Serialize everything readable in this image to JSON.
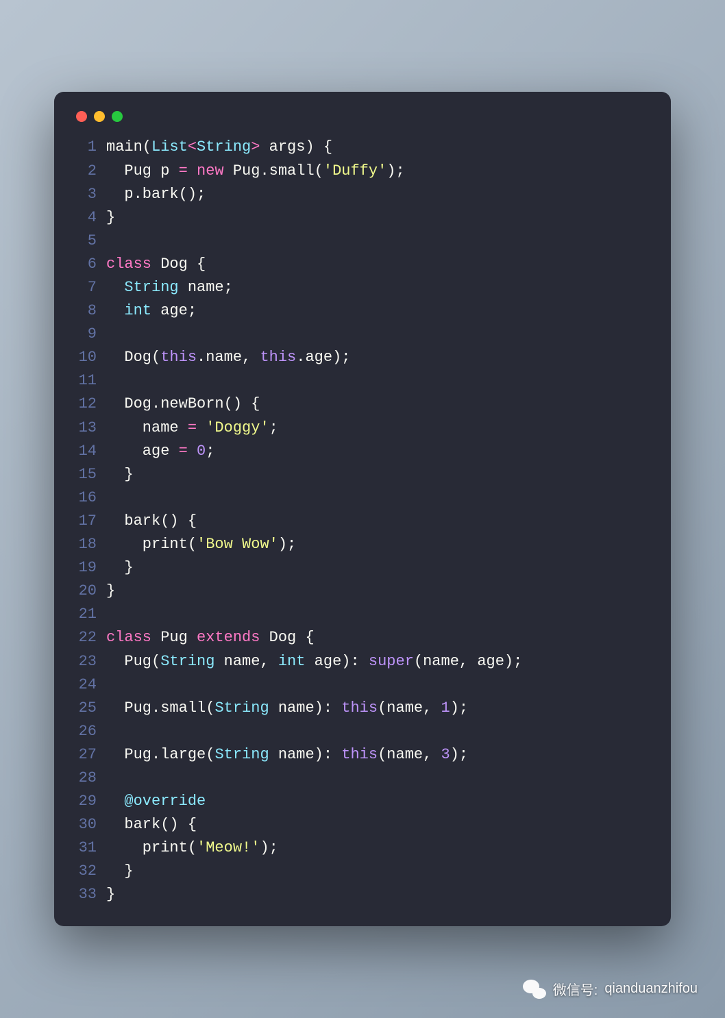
{
  "window": {
    "traffic_lights": [
      "red",
      "yellow",
      "green"
    ]
  },
  "code": {
    "lines": [
      {
        "n": 1,
        "tokens": [
          [
            "main(",
            "default"
          ],
          [
            "List",
            "type"
          ],
          [
            "<",
            "op"
          ],
          [
            "String",
            "type"
          ],
          [
            ">",
            "op"
          ],
          [
            " args) {",
            "default"
          ]
        ]
      },
      {
        "n": 2,
        "tokens": [
          [
            "  Pug p ",
            "default"
          ],
          [
            "=",
            "op"
          ],
          [
            " ",
            "default"
          ],
          [
            "new",
            "keyword"
          ],
          [
            " Pug.small(",
            "default"
          ],
          [
            "'Duffy'",
            "string"
          ],
          [
            ");",
            "default"
          ]
        ]
      },
      {
        "n": 3,
        "tokens": [
          [
            "  p.bark();",
            "default"
          ]
        ]
      },
      {
        "n": 4,
        "tokens": [
          [
            "}",
            "default"
          ]
        ]
      },
      {
        "n": 5,
        "tokens": [
          [
            "",
            "default"
          ]
        ]
      },
      {
        "n": 6,
        "tokens": [
          [
            "class",
            "keyword"
          ],
          [
            " Dog {",
            "default"
          ]
        ]
      },
      {
        "n": 7,
        "tokens": [
          [
            "  ",
            "default"
          ],
          [
            "String",
            "type"
          ],
          [
            " name;",
            "default"
          ]
        ]
      },
      {
        "n": 8,
        "tokens": [
          [
            "  ",
            "default"
          ],
          [
            "int",
            "type"
          ],
          [
            " age;",
            "default"
          ]
        ]
      },
      {
        "n": 9,
        "tokens": [
          [
            "",
            "default"
          ]
        ]
      },
      {
        "n": 10,
        "tokens": [
          [
            "  Dog(",
            "default"
          ],
          [
            "this",
            "this"
          ],
          [
            ".name, ",
            "default"
          ],
          [
            "this",
            "this"
          ],
          [
            ".age);",
            "default"
          ]
        ]
      },
      {
        "n": 11,
        "tokens": [
          [
            "",
            "default"
          ]
        ]
      },
      {
        "n": 12,
        "tokens": [
          [
            "  Dog.newBorn() {",
            "default"
          ]
        ]
      },
      {
        "n": 13,
        "tokens": [
          [
            "    name ",
            "default"
          ],
          [
            "=",
            "op"
          ],
          [
            " ",
            "default"
          ],
          [
            "'Doggy'",
            "string"
          ],
          [
            ";",
            "default"
          ]
        ]
      },
      {
        "n": 14,
        "tokens": [
          [
            "    age ",
            "default"
          ],
          [
            "=",
            "op"
          ],
          [
            " ",
            "default"
          ],
          [
            "0",
            "number"
          ],
          [
            ";",
            "default"
          ]
        ]
      },
      {
        "n": 15,
        "tokens": [
          [
            "  }",
            "default"
          ]
        ]
      },
      {
        "n": 16,
        "tokens": [
          [
            "",
            "default"
          ]
        ]
      },
      {
        "n": 17,
        "tokens": [
          [
            "  bark() {",
            "default"
          ]
        ]
      },
      {
        "n": 18,
        "tokens": [
          [
            "    print(",
            "default"
          ],
          [
            "'Bow Wow'",
            "string"
          ],
          [
            ");",
            "default"
          ]
        ]
      },
      {
        "n": 19,
        "tokens": [
          [
            "  }",
            "default"
          ]
        ]
      },
      {
        "n": 20,
        "tokens": [
          [
            "}",
            "default"
          ]
        ]
      },
      {
        "n": 21,
        "tokens": [
          [
            "",
            "default"
          ]
        ]
      },
      {
        "n": 22,
        "tokens": [
          [
            "class",
            "keyword"
          ],
          [
            " Pug ",
            "default"
          ],
          [
            "extends",
            "keyword"
          ],
          [
            " Dog {",
            "default"
          ]
        ]
      },
      {
        "n": 23,
        "tokens": [
          [
            "  Pug(",
            "default"
          ],
          [
            "String",
            "type"
          ],
          [
            " name, ",
            "default"
          ],
          [
            "int",
            "type"
          ],
          [
            " age): ",
            "default"
          ],
          [
            "super",
            "super"
          ],
          [
            "(name, age);",
            "default"
          ]
        ]
      },
      {
        "n": 24,
        "tokens": [
          [
            "",
            "default"
          ]
        ]
      },
      {
        "n": 25,
        "tokens": [
          [
            "  Pug.small(",
            "default"
          ],
          [
            "String",
            "type"
          ],
          [
            " name): ",
            "default"
          ],
          [
            "this",
            "this"
          ],
          [
            "(name, ",
            "default"
          ],
          [
            "1",
            "number"
          ],
          [
            ");",
            "default"
          ]
        ]
      },
      {
        "n": 26,
        "tokens": [
          [
            "",
            "default"
          ]
        ]
      },
      {
        "n": 27,
        "tokens": [
          [
            "  Pug.large(",
            "default"
          ],
          [
            "String",
            "type"
          ],
          [
            " name): ",
            "default"
          ],
          [
            "this",
            "this"
          ],
          [
            "(name, ",
            "default"
          ],
          [
            "3",
            "number"
          ],
          [
            ");",
            "default"
          ]
        ]
      },
      {
        "n": 28,
        "tokens": [
          [
            "",
            "default"
          ]
        ]
      },
      {
        "n": 29,
        "tokens": [
          [
            "  ",
            "default"
          ],
          [
            "@override",
            "ann"
          ]
        ]
      },
      {
        "n": 30,
        "tokens": [
          [
            "  bark() {",
            "default"
          ]
        ]
      },
      {
        "n": 31,
        "tokens": [
          [
            "    print(",
            "default"
          ],
          [
            "'Meow!'",
            "string"
          ],
          [
            ");",
            "default"
          ]
        ]
      },
      {
        "n": 32,
        "tokens": [
          [
            "  }",
            "default"
          ]
        ]
      },
      {
        "n": 33,
        "tokens": [
          [
            "}",
            "default"
          ]
        ]
      }
    ]
  },
  "watermark": {
    "label": "微信号:",
    "id": "qianduanzhifou"
  },
  "colors": {
    "background": "#282a36",
    "foreground": "#f8f8f2",
    "line_number": "#6272a4",
    "type": "#8be9fd",
    "keyword": "#ff79c6",
    "string": "#f1fa8c",
    "number": "#bd93f9",
    "this": "#bd93f9"
  }
}
